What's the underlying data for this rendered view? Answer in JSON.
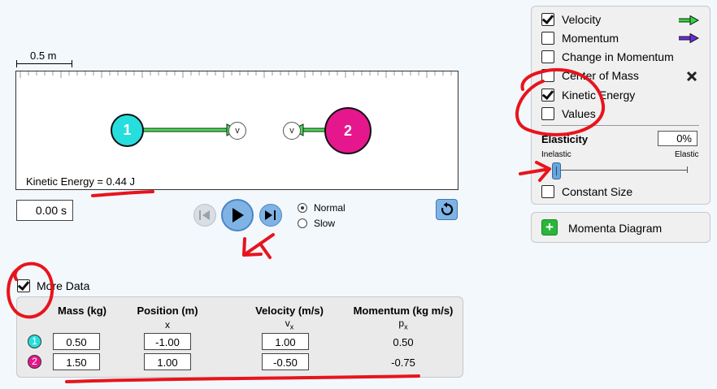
{
  "scale_bar": {
    "label": "0.5 m"
  },
  "readouts": {
    "kinetic_energy": "Kinetic Energy = 0.44 J",
    "time": "0.00 s"
  },
  "balls": [
    {
      "id": "1",
      "color": "#27dede",
      "velocity": "1.00"
    },
    {
      "id": "2",
      "color": "#e6168d",
      "velocity": "-0.50"
    }
  ],
  "vector_label": "v",
  "playback": {
    "speed_options": [
      {
        "label": "Normal",
        "selected": true
      },
      {
        "label": "Slow",
        "selected": false
      }
    ]
  },
  "control_panel": {
    "options": [
      {
        "label": "Velocity",
        "checked": true,
        "arrow_color": "#2fd940"
      },
      {
        "label": "Momentum",
        "checked": false,
        "arrow_color": "#6a2be2"
      },
      {
        "label": "Change in Momentum",
        "checked": false
      },
      {
        "label": "Center of Mass",
        "checked": false,
        "icon": "x-mark-icon"
      },
      {
        "label": "Kinetic Energy",
        "checked": true
      },
      {
        "label": "Values",
        "checked": false
      }
    ],
    "elasticity": {
      "title": "Elasticity",
      "value": "0%",
      "min_label": "Inelastic",
      "max_label": "Elastic",
      "level": 0
    },
    "constant_size": {
      "label": "Constant Size",
      "checked": false
    }
  },
  "momenta_diagram": {
    "label": "Momenta Diagram"
  },
  "more_data": {
    "label": "More Data",
    "checked": true,
    "headers": [
      {
        "title": "Mass (kg)",
        "sub": ""
      },
      {
        "title": "Position (m)",
        "sub": "x"
      },
      {
        "title": "Velocity (m/s)",
        "sub": "v",
        "sub_subscript": "x"
      },
      {
        "title": "Momentum (kg m/s)",
        "sub": "p",
        "sub_subscript": "x"
      }
    ],
    "rows": [
      {
        "ball": "1",
        "mass": "0.50",
        "position": "-1.00",
        "velocity": "1.00",
        "momentum": "0.50"
      },
      {
        "ball": "2",
        "mass": "1.50",
        "position": "1.00",
        "velocity": "-0.50",
        "momentum": "-0.75"
      }
    ]
  },
  "annotation_color": "#e8141c"
}
